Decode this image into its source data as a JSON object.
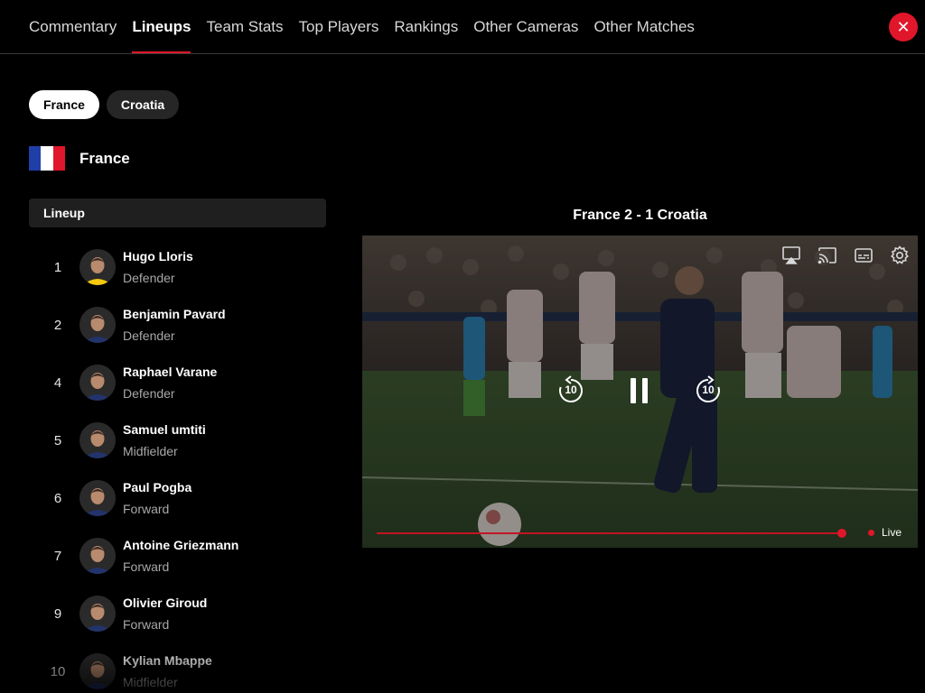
{
  "nav": {
    "tabs": [
      {
        "label": "Commentary",
        "active": false
      },
      {
        "label": "Lineups",
        "active": true
      },
      {
        "label": "Team Stats",
        "active": false
      },
      {
        "label": "Top Players",
        "active": false
      },
      {
        "label": "Rankings",
        "active": false
      },
      {
        "label": "Other Cameras",
        "active": false
      },
      {
        "label": "Other Matches",
        "active": false
      }
    ],
    "close_icon": "close-icon",
    "close_symbol": "✕"
  },
  "teams": {
    "options": [
      "France",
      "Croatia"
    ],
    "selected": "France"
  },
  "team_header": {
    "name": "France",
    "flag_colors": [
      "#1f3fa8",
      "#ffffff",
      "#e0162b"
    ]
  },
  "lineup": {
    "heading": "Lineup",
    "players": [
      {
        "number": "1",
        "name": "Hugo Lloris",
        "position": "Defender",
        "jersey": "#f6c90e"
      },
      {
        "number": "2",
        "name": "Benjamin Pavard",
        "position": "Defender",
        "jersey": "#23336b"
      },
      {
        "number": "4",
        "name": "Raphael Varane",
        "position": "Defender",
        "jersey": "#23336b"
      },
      {
        "number": "5",
        "name": "Samuel umtiti",
        "position": "Midfielder",
        "jersey": "#23336b"
      },
      {
        "number": "6",
        "name": "Paul Pogba",
        "position": "Forward",
        "jersey": "#23336b"
      },
      {
        "number": "7",
        "name": "Antoine Griezmann",
        "position": "Forward",
        "jersey": "#23336b"
      },
      {
        "number": "9",
        "name": "Olivier Giroud",
        "position": "Forward",
        "jersey": "#23336b"
      },
      {
        "number": "10",
        "name": "Kylian Mbappe",
        "position": "Midfielder",
        "jersey": "#23336b"
      }
    ]
  },
  "video": {
    "score_title": "France 2 - 1 Croatia",
    "live_label": "Live",
    "progress": 0.99,
    "top_icons": [
      "airplay-icon",
      "cast-icon",
      "subtitles-icon",
      "settings-icon"
    ],
    "controls": {
      "rewind_seconds": "10",
      "forward_seconds": "10",
      "state": "playing"
    },
    "accent": "#e0162b"
  }
}
